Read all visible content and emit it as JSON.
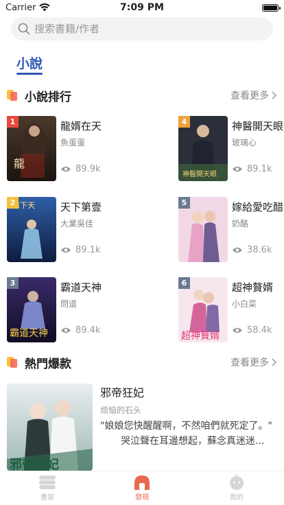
{
  "status": {
    "carrier": "Carrier",
    "time": "7:09 PM"
  },
  "search": {
    "placeholder": "搜索書籍/作者"
  },
  "tabs": [
    {
      "label": "小說"
    }
  ],
  "ranking": {
    "title": "小說排行",
    "more": "查看更多",
    "items": [
      {
        "rank": "1",
        "title": "龍婿在天",
        "author": "魚蛋蛋",
        "views": "89.9k"
      },
      {
        "rank": "4",
        "title": "神醫開天眼",
        "author": "玻璃心",
        "views": "89.1k"
      },
      {
        "rank": "2",
        "title": "天下第壹",
        "author": "大業吳佳",
        "views": "89.1k"
      },
      {
        "rank": "5",
        "title": "嫁給愛吃醋",
        "author": "奶酪",
        "views": "38.6k"
      },
      {
        "rank": "3",
        "title": "霸道天神",
        "author": "問道",
        "views": "89.4k"
      },
      {
        "rank": "6",
        "title": "超神贅婿",
        "author": "小白菜",
        "views": "58.4k"
      }
    ],
    "badge_colors": [
      "#e84a3c",
      "#f0a23b",
      "#f5c03a",
      "#6b7a8f",
      "#6b7a8f",
      "#6b7a8f"
    ]
  },
  "hot": {
    "title": "熱門爆款",
    "more": "查看更多",
    "item": {
      "title": "邪帝狂妃",
      "author": "烦恼的石头",
      "desc_line1": "\"娘娘您快醒醒啊，不然咱們就死定了。\"",
      "desc_line2": "哭泣聲在耳邊想起，蘇念真迷迷..."
    }
  },
  "tabbar": {
    "items": [
      {
        "label": "書架",
        "icon": "bookshelf-icon"
      },
      {
        "label": "發現",
        "icon": "discover-icon"
      },
      {
        "label": "我的",
        "icon": "profile-icon"
      }
    ],
    "active_color": "#e86a4e"
  },
  "accent": "#2a57b8"
}
